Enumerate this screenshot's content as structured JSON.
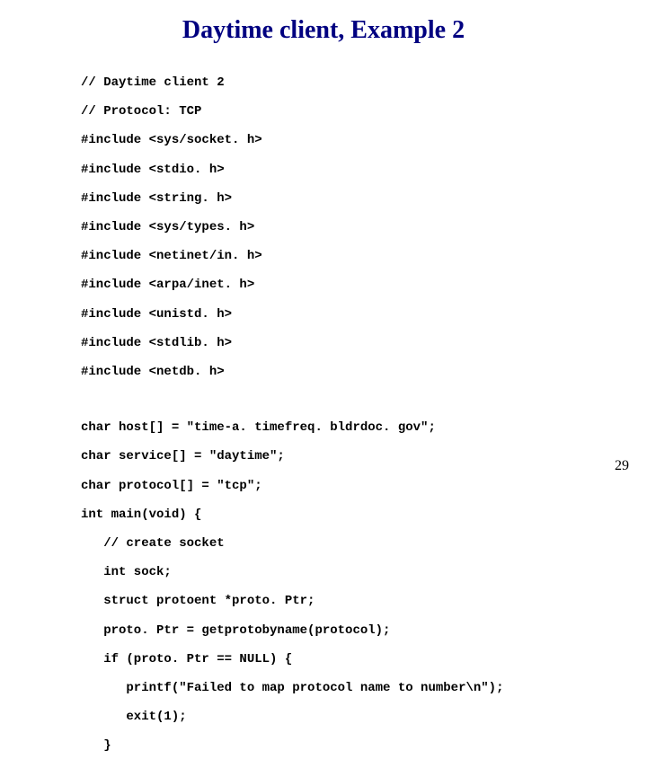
{
  "title": "Daytime client, Example 2",
  "code": {
    "line0": "// Daytime client 2",
    "line1": "// Protocol: TCP",
    "line2": "#include <sys/socket. h>",
    "line3": "#include <stdio. h>",
    "line4": "#include <string. h>",
    "line5": "#include <sys/types. h>",
    "line6": "#include <netinet/in. h>",
    "line7": "#include <arpa/inet. h>",
    "line8": "#include <unistd. h>",
    "line9": "#include <stdlib. h>",
    "line10": "#include <netdb. h>",
    "line11": "char host[] = \"time-a. timefreq. bldrdoc. gov\";",
    "line12": "char service[] = \"daytime\";",
    "line13": "char protocol[] = \"tcp\";",
    "line14": "int main(void) {",
    "line15": "   // create socket",
    "line16": "   int sock;",
    "line17": "   struct protoent *proto. Ptr;",
    "line18": "   proto. Ptr = getprotobyname(protocol);",
    "line19": "   if (proto. Ptr == NULL) {",
    "line20": "      printf(\"Failed to map protocol name to number\\n\");",
    "line21": "      exit(1);",
    "line22": "   }"
  },
  "page_number": "29"
}
